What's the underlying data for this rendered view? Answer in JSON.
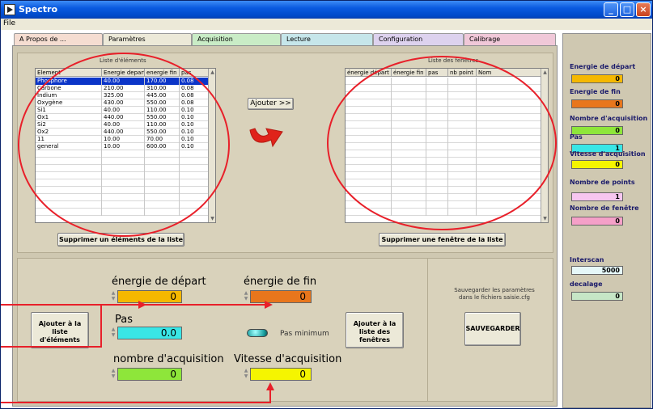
{
  "window": {
    "title": "Spectro"
  },
  "menu": {
    "file": "File"
  },
  "tabs": [
    {
      "label": "A Propos de ...",
      "color": "#f5ddd1"
    },
    {
      "label": "Paramètres",
      "color": "#ece9d8"
    },
    {
      "label": "Acquisition",
      "color": "#c9ecc6"
    },
    {
      "label": "Lecture",
      "color": "#c6e6ea"
    },
    {
      "label": "Configuration",
      "color": "#ddd2ee"
    },
    {
      "label": "Calibrage",
      "color": "#f0c8d8"
    }
  ],
  "elements_table": {
    "label": "Liste d'éléments",
    "headers": [
      "Element",
      "Energie depart",
      "energie fin",
      "pas"
    ],
    "rows": [
      [
        "Phosphore",
        "40.00",
        "170.00",
        "0.08"
      ],
      [
        "Carbone",
        "210.00",
        "310.00",
        "0.08"
      ],
      [
        "Indium",
        "325.00",
        "445.00",
        "0.08"
      ],
      [
        "Oxygène",
        "430.00",
        "550.00",
        "0.08"
      ],
      [
        "Si1",
        "40.00",
        "110.00",
        "0.10"
      ],
      [
        "Ox1",
        "440.00",
        "550.00",
        "0.10"
      ],
      [
        "Si2",
        "40.00",
        "110.00",
        "0.10"
      ],
      [
        "Ox2",
        "440.00",
        "550.00",
        "0.10"
      ],
      [
        "11",
        "10.00",
        "70.00",
        "0.10"
      ],
      [
        "general",
        "10.00",
        "600.00",
        "0.10"
      ]
    ]
  },
  "windows_table": {
    "label": "Liste des fenêtres",
    "headers": [
      "énergie départ",
      "énergie fin",
      "pas",
      "nb point",
      "Nom"
    ]
  },
  "buttons": {
    "add": "Ajouter >>",
    "remove_element": "Supprimer un éléments de la liste",
    "remove_window": "Supprimer une fenêtre de la liste",
    "add_to_elements": "Ajouter à la liste d'éléments",
    "add_to_windows": "Ajouter à la liste des fenêtres",
    "save": "SAUVEGARDER"
  },
  "form": {
    "energie_depart": {
      "label": "énergie de départ",
      "value": "0",
      "color": "#f5b800"
    },
    "energie_fin": {
      "label": "énergie de fin",
      "value": "0",
      "color": "#e8761c"
    },
    "pas": {
      "label": "Pas",
      "value": "0.0",
      "color": "#39e6e6"
    },
    "pas_minimum": {
      "label": "Pas minimum"
    },
    "nombre_acquisition": {
      "label": "nombre d'acquisition",
      "value": "0",
      "color": "#8ee63a"
    },
    "vitesse_acquisition": {
      "label": "Vitesse d'acquisition",
      "value": "0",
      "color": "#f5f500"
    }
  },
  "save_note": "Sauvegarder les paramètres dans le fichiers saisie.cfg",
  "right_panel": [
    {
      "label": "Energie de départ",
      "value": "0",
      "color": "#f5b800"
    },
    {
      "label": "Energie de fin",
      "value": "0",
      "color": "#e8761c"
    },
    {
      "label": "Nombre d'acquisition",
      "value": "0",
      "color": "#8ee63a"
    },
    {
      "label": "Pas",
      "value": "1",
      "color": "#39e6e6"
    },
    {
      "label": "Vitesse d'acquisition",
      "value": "0",
      "color": "#f5f500"
    },
    {
      "label": "Nombre de points",
      "value": "1",
      "color": "#f7c6f0"
    },
    {
      "label": "Nombre de fenêtre",
      "value": "0",
      "color": "#f5a0c8"
    },
    {
      "label": "Interscan",
      "value": "5000",
      "color": "#e6f8f8"
    },
    {
      "label": "decalage",
      "value": "0",
      "color": "#c6e6c6"
    }
  ],
  "annotation_color": "#e8202a"
}
